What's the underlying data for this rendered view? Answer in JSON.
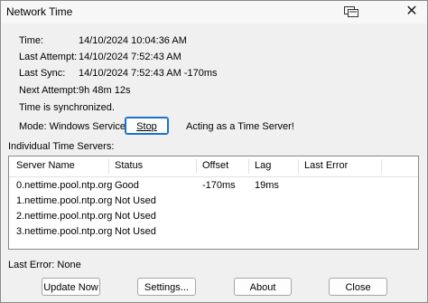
{
  "window": {
    "title": "Network Time",
    "close_glyph": "✕"
  },
  "status": {
    "time_label": "Time:",
    "time_value": "14/10/2024 10:04:36 AM",
    "last_attempt_label": "Last Attempt:",
    "last_attempt_value": "14/10/2024 7:52:43 AM",
    "last_sync_label": "Last Sync:",
    "last_sync_value": "14/10/2024 7:52:43 AM -170ms",
    "next_attempt_label": "Next Attempt:",
    "next_attempt_value": "9h 48m 12s",
    "sync_message": "Time is synchronized.",
    "mode_text": "Mode: Windows Service",
    "stop_label": "Stop",
    "server_note": "Acting as a Time Server!"
  },
  "servers": {
    "section_label": "Individual Time Servers:",
    "columns": [
      "Server Name",
      "Status",
      "Offset",
      "Lag",
      "Last Error"
    ],
    "rows": [
      [
        "0.nettime.pool.ntp.org",
        "Good",
        "-170ms",
        "19ms",
        ""
      ],
      [
        "1.nettime.pool.ntp.org",
        "Not Used",
        "",
        "",
        ""
      ],
      [
        "2.nettime.pool.ntp.org",
        "Not Used",
        "",
        "",
        ""
      ],
      [
        "3.nettime.pool.ntp.org",
        "Not Used",
        "",
        "",
        ""
      ]
    ]
  },
  "footer": {
    "last_error_text": "Last Error:  None",
    "update_label": "Update Now",
    "settings_label": "Settings...",
    "about_label": "About",
    "close_label": "Close"
  },
  "icons": {
    "titlebar_icon": "tray-window-icon"
  },
  "colors": {
    "focus_border": "#1a73c8",
    "list_bg": "#ffffff",
    "window_bg": "#f0f0f0"
  }
}
